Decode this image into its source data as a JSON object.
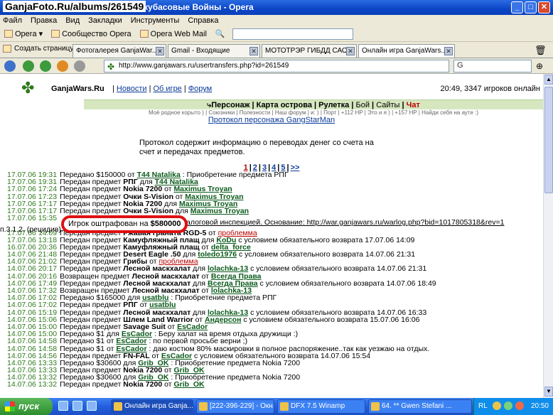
{
  "window": {
    "title": "анджубасовые Войны - Opera",
    "watermark": "GanjaFoto.Ru/albums/261549"
  },
  "menu": [
    "Файл",
    "Правка",
    "Вид",
    "Закладки",
    "Инструменты",
    "Справка"
  ],
  "bookmarks": [
    "Opera",
    "Сообщество Opera",
    "Opera Web Mail"
  ],
  "tabs": {
    "new_tab": "Создать страницу",
    "items": [
      "Фотогалерея GanjaWar...",
      "Gmail - Входящие",
      "МОТОТРЭР ГИБДД САО...",
      "Онлайн игра GanjaWars..."
    ]
  },
  "address": {
    "url": "http://www.ganjawars.ru/usertransfers.php?id=261549",
    "search": "G"
  },
  "site": {
    "name": "GanjaWars.Ru",
    "nav": [
      "Новости",
      "Об игре",
      "Форум"
    ],
    "online": "20:49, 3347 игроков онлайн",
    "greenbar": [
      "Персонаж",
      "Карта острова",
      "Рулетка",
      "Бой",
      "Сайты",
      "Чат"
    ],
    "subnav": "Моё родное корыто ) | Союзники | Полезности | Наш форум | и: ) | Порт | +112 HP | Это и я ) | +157 HP | Найди себя на ауте :)",
    "protocol_link": "Протокол персонажа GangStarMan",
    "description": "Протокол содержит информацию о переводах денег со счета на счет и передачах предметов.",
    "pages": [
      "1",
      "2",
      "3",
      "4",
      "5",
      ">>"
    ]
  },
  "fine": {
    "prefix": "Игрок оштрафован на ",
    "amount": "$580000",
    "rest": "алоговой инспекцией. Основание: http://war.ganjawars.ru/warlog.php?bid=1017805318&rev=1",
    "wrap": "п.3.1.2. (рецидив)."
  },
  "log": [
    [
      "17.07.06 19:31",
      "Передано $150000 от ",
      "T44 Natalika",
      " : Приобретение предмета РПГ"
    ],
    [
      "17.07.06 19:31",
      "Передан предмет ",
      "РПГ",
      " для ",
      "T44 Natalika"
    ],
    [
      "17.07.06 17:24",
      "Передан предмет ",
      "Nokia 7200",
      " от ",
      "Maximus Troyan"
    ],
    [
      "17.07.06 17:23",
      "Передан предмет ",
      "Очки S-Vision",
      " от ",
      "Maximus Troyan"
    ],
    [
      "17.07.06 17:17",
      "Передан предмет ",
      "Nokia 7200",
      " для ",
      "Maximus Troyan"
    ],
    [
      "17.07.06 17:17",
      "Передан предмет ",
      "Очки S-Vision",
      " для ",
      "Maximus Troyan"
    ],
    [
      "17.07.06 15:35",
      "",
      "",
      "",
      ""
    ],
    [
      "",
      "",
      "",
      "",
      ""
    ],
    [
      "17.07.06 14:09",
      "Передан предмет ",
      "Ржавая граната RGD-5",
      " от ",
      "проблемма"
    ],
    [
      "17.07.06 13:18",
      "Передан предмет ",
      "Камуфляжный плащ",
      " для ",
      "KoDu",
      " с условием обязательного возврата 17.07.06 14:09"
    ],
    [
      "16.07.06 20:36",
      "Передан предмет ",
      "Камуфляжный плащ",
      " от ",
      "delta_force"
    ],
    [
      "14.07.06 21:48",
      "Передан предмет ",
      "Desert Eagle .50",
      " для ",
      "toledo1976",
      " с условием обязательного возврата 14.07.06 21:31"
    ],
    [
      "14.07.06 21:02",
      "Передан предмет ",
      "Грибы",
      " от ",
      "проблемма"
    ],
    [
      "14.07.06 20:17",
      "Передан предмет ",
      "Лесной маскхалат",
      " для ",
      "lolachka-13",
      " с условием обязательного возврата 14.07.06 21:31"
    ],
    [
      "14.07.06 20:16",
      "Возвращен предмет ",
      "Лесной маскхалат",
      " от ",
      "Всегда Права"
    ],
    [
      "14.07.06 17:49",
      "Передан предмет ",
      "Лесной маскхалат",
      " для ",
      "Всегда Права",
      " с условием обязательного возврата 14.07.06 18:49"
    ],
    [
      "14.07.06 17:32",
      "Возвращен предмет ",
      "Лесной маскхалат",
      " от ",
      "lolachka-13"
    ],
    [
      "14.07.06 17:02",
      "Передано $165000 для ",
      "usatblu",
      " : Приобретение предмета РПГ"
    ],
    [
      "14.07.06 17:02",
      "Передан предмет ",
      "РПГ",
      " от ",
      "usatblu"
    ],
    [
      "14.07.06 15:19",
      "Передан предмет ",
      "Лесной маскхалат",
      " для ",
      "lolachka-13",
      " с условием обязательного возврата 14.07.06 16:33"
    ],
    [
      "14.07.06 15:06",
      "Передан предмет ",
      "Шлем Land Warrior",
      " от ",
      "Андерсон",
      " с условием обязательного возврата 15.07.06 16:06"
    ],
    [
      "14.07.06 15:00",
      "Передан предмет ",
      "Savage Suit",
      " от ",
      "EsCador"
    ],
    [
      "14.07.06 15:00",
      "Передано $1 для ",
      "EsCador",
      " : Беру халат на время отдыха дружищи :)"
    ],
    [
      "14.07.06 14:58",
      "Передано $1 от ",
      "EsCador",
      " : по первой просьбе верни ;)"
    ],
    [
      "14.07.06 14:58",
      "Передано $1 от ",
      "EsCador",
      " : даю костюм 80% маскировки в полное распоряжение..так как уезжаю на отдых."
    ],
    [
      "14.07.06 14:56",
      "Передан предмет ",
      "FN-FAL",
      " от ",
      "EsCador",
      " с условием обязательного возврата 14.07.06 15:54"
    ],
    [
      "14.07.06 13:33",
      "Передано $30600 для ",
      "Grib_OK",
      " : Приобретение предмета Nokia 7200"
    ],
    [
      "14.07.06 13:33",
      "Передан предмет ",
      "Nokia 7200",
      " от ",
      "Grib_OK"
    ],
    [
      "14.07.06 13:32",
      "Передано $30600 для ",
      "Grib_OK",
      " : Приобретение предмета Nokia 7200"
    ],
    [
      "14.07.06 13:32",
      "Передан предмет ",
      "Nokia 7200",
      " от ",
      "Grib_OK"
    ]
  ],
  "taskbar": {
    "start": "пуск",
    "items": [
      "Онлайн игра Ganja...",
      "[222-396-229] - Окн...",
      "DFX 7.5 Winamp",
      "64. ** Gwen Stefani ..."
    ],
    "lang": "RL",
    "clock": "20:50"
  },
  "colors": {
    "accent_green": "#2f7a1c",
    "link_blue": "#0a3a9a",
    "highlight_red": "#e01010"
  }
}
